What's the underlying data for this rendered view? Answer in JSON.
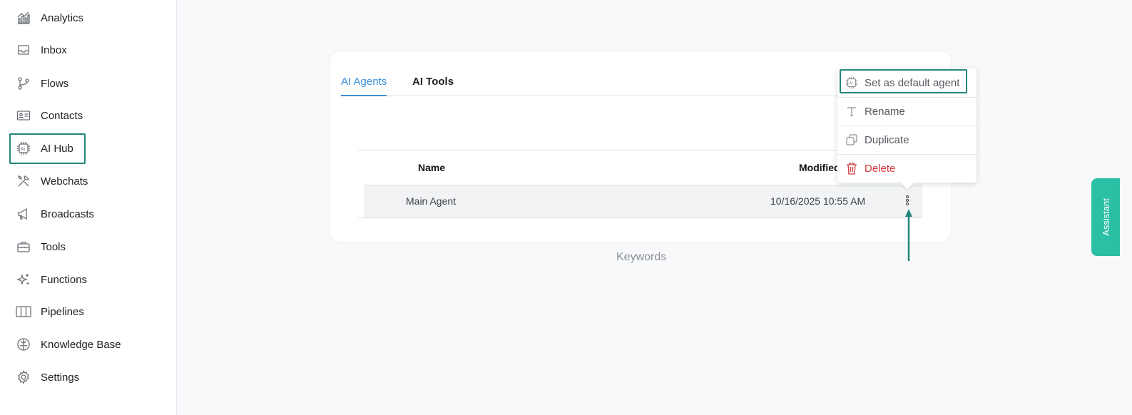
{
  "sidebar": {
    "items": [
      {
        "label": "Analytics",
        "icon": "analytics-icon"
      },
      {
        "label": "Inbox",
        "icon": "inbox-icon"
      },
      {
        "label": "Flows",
        "icon": "flows-icon"
      },
      {
        "label": "Contacts",
        "icon": "contacts-icon"
      },
      {
        "label": "AI Hub",
        "icon": "ai-chip-icon"
      },
      {
        "label": "Webchats",
        "icon": "tools-cross-icon"
      },
      {
        "label": "Broadcasts",
        "icon": "megaphone-icon"
      },
      {
        "label": "Tools",
        "icon": "toolbox-icon"
      },
      {
        "label": "Functions",
        "icon": "sparkle-icon"
      },
      {
        "label": "Pipelines",
        "icon": "columns-icon"
      },
      {
        "label": "Knowledge Base",
        "icon": "brain-icon"
      },
      {
        "label": "Settings",
        "icon": "gear-icon"
      }
    ]
  },
  "tabs": [
    {
      "label": "AI Agents",
      "active": true
    },
    {
      "label": "AI Tools",
      "active": false
    }
  ],
  "table": {
    "headers": {
      "name": "Name",
      "modified": "Modified"
    },
    "rows": [
      {
        "name": "Main Agent",
        "modified": "10/16/2025 10:55 AM"
      }
    ]
  },
  "below_card": "Keywords",
  "context_menu": {
    "items": [
      {
        "label": "Set as default agent",
        "icon": "ai-chip-icon"
      },
      {
        "label": "Rename",
        "icon": "text-icon"
      },
      {
        "label": "Duplicate",
        "icon": "copy-icon"
      },
      {
        "label": "Delete",
        "icon": "trash-icon"
      }
    ]
  },
  "assistant_label": "Assistant",
  "colors": {
    "accent": "#3b8fd9",
    "highlight": "#23867a",
    "danger": "#d23b3b",
    "assistant": "#2bbfa6"
  }
}
